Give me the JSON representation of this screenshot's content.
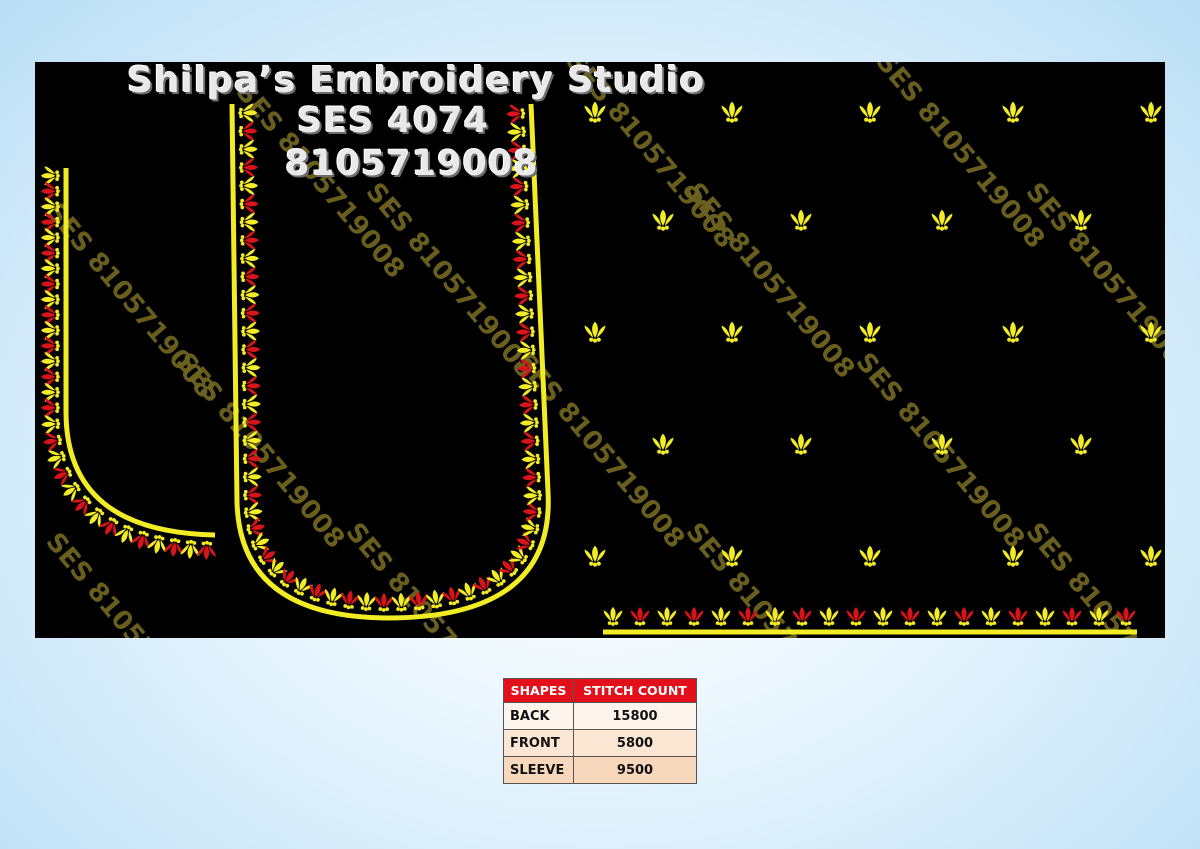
{
  "studio": {
    "name": "Shilpa’s Embroidery Studio",
    "design_code": "SES 4074",
    "phone": "8105719008"
  },
  "watermark": {
    "text": "SES 8105719008"
  },
  "colors": {
    "canvas": "#000000",
    "thread_yellow": "#f2ec25",
    "thread_red": "#d8131a",
    "watermark": "#6f641f",
    "table_header": "#e3101c"
  },
  "stitch_table": {
    "headers": [
      "SHAPES",
      "STITCH COUNT"
    ],
    "rows": [
      {
        "shape": "BACK",
        "count": "15800"
      },
      {
        "shape": "FRONT",
        "count": "5800"
      },
      {
        "shape": "SLEEVE",
        "count": "9500"
      }
    ]
  }
}
